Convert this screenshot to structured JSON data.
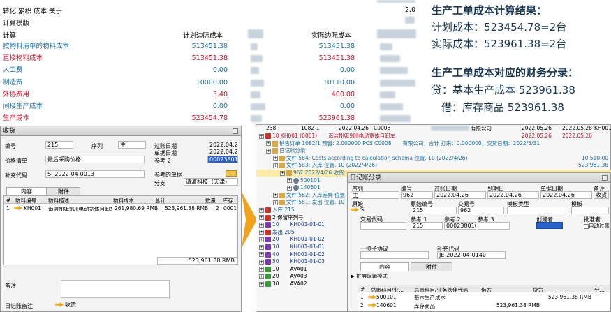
{
  "cost_table": {
    "top_partial": "",
    "menu": "转化 累积 成本 关于",
    "version": "2.0",
    "subtitle": "计算模版",
    "headers": {
      "calc": "计算",
      "planned": "计划边际成本",
      "actual": "实际边际成本"
    },
    "rows": [
      {
        "label": "按物料清单的物料成本",
        "planned": "513451.38",
        "actual": "513451.38",
        "color": "#1a6fa0"
      },
      {
        "label": "直接物料成本",
        "planned": "513451.38",
        "actual": "513451.38",
        "color": "#c0142c"
      },
      {
        "label": "人工费",
        "planned": "0.00",
        "actual": "0.00",
        "color": "#1a6fa0"
      },
      {
        "label": "制造费",
        "planned": "10000.00",
        "actual": "10110.00",
        "color": "#1a6fa0"
      },
      {
        "label": "外协费用",
        "planned": "3.40",
        "actual": "400.00",
        "color": "#c0142c"
      },
      {
        "label": "间接生产成本",
        "planned": "0.00",
        "actual": "0.00",
        "color": "#1a6fa0"
      },
      {
        "label": "生产成本",
        "planned": "523454.78",
        "actual": "523961.38",
        "color": "#c0142c"
      }
    ]
  },
  "annotation": {
    "title1": "生产工单成本计算结果：",
    "line1": "计划成本：523454.78=2台",
    "line2": "实际成本：523961.38=2台",
    "title2": "生产工单成本对应的财务分录：",
    "line3": "贷：基本生产成本  523961.38",
    "line4": "借：库存商品  523961.38"
  },
  "receipt_window": {
    "title": "收货",
    "fields": {
      "number_label": "编号",
      "number_value": "215",
      "series_label": "序列",
      "series_value": "主",
      "posting_date_label": "过账日期",
      "posting_date_value": "2022.04.26",
      "doc_date_label": "单据日期",
      "doc_date_value": "2022.04.26",
      "price_list_label": "价格清单",
      "price_list_value": "最后采购价格",
      "ref2_label": "参考 2",
      "ref2_value": "000238010",
      "ref_code_label": "补充代码",
      "ref_code_value": "SI-2022-04-0013",
      "ref_doc_label": "参考的单据",
      "ref_doc_btn": "...",
      "branch_label": "分支",
      "branch_value": "请清科技（天津）"
    },
    "tabs": [
      "内容",
      "附件"
    ],
    "grid_headers": [
      "#",
      "物料编号",
      "物料描述",
      "物料成本",
      "总计",
      "数量",
      "库存"
    ],
    "grid_row": {
      "num": "1",
      "item": "KH001",
      "desc": "谐洁NKE90Ⅱ电动宽体自卸车",
      "cost": "261,980.69 RMB",
      "total": "523,961.38 RMB",
      "qty": "2",
      "wh": "0001"
    },
    "grid_total": "523,961.38 RMB",
    "remarks_label": "备注",
    "journal_remark_label": "日记账备注",
    "journal_remark_value": "收货"
  },
  "tree_window": {
    "header_row": {
      "num": "238",
      "doc": "1082-1",
      "date": "2022.04.26",
      "code": "C0008",
      "partner": "有限公司",
      "d1": "2022.05.26",
      "d2": "2022.05.28",
      "item": "KH001"
    },
    "rows": [
      {
        "indent": 0,
        "icon": "flag",
        "text": "10    KH001 (0001)",
        "extra": "谐洁NKE90Ⅱ电动宽体自卸车",
        "color": "#c0142c",
        "d1": "2022.05.26",
        "d2": "2022.05.26"
      },
      {
        "indent": 1,
        "icon": "doc",
        "text": "销售订单 1082/1 预留: 2.000000 PCS C0008",
        "extra": "有限公司，合计 打来：0.000000，交货日期：2022/5/31",
        "color": "#1a6fa0"
      },
      {
        "indent": 1,
        "icon": "doc",
        "text": "日记账分录",
        "color": "#1a6fa0"
      },
      {
        "indent": 2,
        "icon": "doc",
        "text": "文件 584: Costs according to calculation schema 位置. 10   (2022/4/26)",
        "color": "#1a6fa0",
        "amount": "10,510.00"
      },
      {
        "indent": 2,
        "icon": "doc",
        "text": "文件 583: 入库 位置. 10   (2022/4/26)",
        "color": "#1a6fa0",
        "amount": "523,961.38"
      },
      {
        "indent": 3,
        "icon": "doc",
        "text": "962 2022/4/26 收货",
        "color": "#1a6fa0",
        "selected": true
      },
      {
        "indent": 4,
        "icon": "gear",
        "text": "500101",
        "color": "#1a6fa0"
      },
      {
        "indent": 4,
        "icon": "gear",
        "text": "140601",
        "color": "#1a6fa0"
      },
      {
        "indent": 2,
        "icon": "doc",
        "text": "文件 582: 入库差异 位置.",
        "color": "#1a6fa0"
      },
      {
        "indent": 2,
        "icon": "doc",
        "text": "文件 581: 发出 位置. 10",
        "color": "#1a6fa0"
      },
      {
        "indent": 0,
        "icon": "flag",
        "text": "入库 215",
        "color": "#1a6fa0"
      },
      {
        "indent": 0,
        "icon": "flag",
        "text": "2 保留序列号",
        "color": "#000"
      },
      {
        "indent": 0,
        "icon": "cube",
        "text": "10",
        "extra": "KH001-01-01",
        "color": "#1a3ea0"
      },
      {
        "indent": 0,
        "icon": "flag",
        "text": "发出 205",
        "color": "#1a3ea0"
      },
      {
        "indent": 0,
        "icon": "cube",
        "text": "20",
        "extra": "KH001-01-02",
        "color": "#1a3ea0"
      },
      {
        "indent": 0,
        "icon": "cube",
        "text": "30",
        "extra": "KH001-01-01",
        "color": "#1a3ea0"
      },
      {
        "indent": 0,
        "icon": "cube",
        "text": "40",
        "extra": "KH001-01-02",
        "color": "#1a3ea0"
      },
      {
        "indent": 0,
        "icon": "cube",
        "text": "50",
        "extra": "KH001-01-03",
        "color": "#1a3ea0"
      },
      {
        "indent": 0,
        "icon": "green",
        "text": "10",
        "extra": "AVA01",
        "color": "#000"
      },
      {
        "indent": 0,
        "icon": "green",
        "text": "20",
        "extra": "AVA03",
        "color": "#000"
      },
      {
        "indent": 0,
        "icon": "green",
        "text": "30",
        "extra": "AVA02",
        "color": "#000"
      }
    ]
  },
  "gl_window": {
    "title": "日记账分录",
    "hdr1": {
      "series": "序列",
      "number": "编号",
      "posting": "过账日期",
      "due": "到期日",
      "docdate": "单据日期",
      "remark": "备注"
    },
    "val1": {
      "series": "主",
      "number": "962",
      "posting": "2022.04.26",
      "due": "2022.04.26",
      "docdate": "2022.04.26",
      "remark": "收货"
    },
    "hdr2": {
      "orig": "原始",
      "origno": "原始编号",
      "transno": "交易号",
      "tmpl_type": "模板类型",
      "tmpl": "模板"
    },
    "val2": {
      "orig": "SI",
      "origno": "215",
      "transno": "962"
    },
    "hdr3": {
      "tcode": "交易代码",
      "ref1": "参考 1",
      "ref2": "参考 2",
      "ref3": "参考 3",
      "creator": "创建者",
      "approver": "批准者"
    },
    "val3": {
      "ref1": "215",
      "ref2": "000238010",
      "creator": "",
      "auto": "自动过账"
    },
    "agreement_label": "一揽子协议",
    "supp_label": "补充代码",
    "supp_value": "JE-2022-04-0140",
    "tabs": [
      "内容",
      "附件"
    ],
    "expand_label": "扩展编辑模式",
    "grid_headers": [
      "#",
      "总账科目/业...",
      "总账科目/业务伙伴代码",
      "借方",
      "贷方",
      "分..."
    ],
    "rows": [
      {
        "num": "1",
        "acct": "500101",
        "name": "基本生产成本",
        "debit": "",
        "credit": "523,961.38 RMB"
      },
      {
        "num": "2",
        "acct": "140601",
        "name": "库存商品",
        "debit": "523,961.38 RMB",
        "credit": ""
      }
    ]
  }
}
